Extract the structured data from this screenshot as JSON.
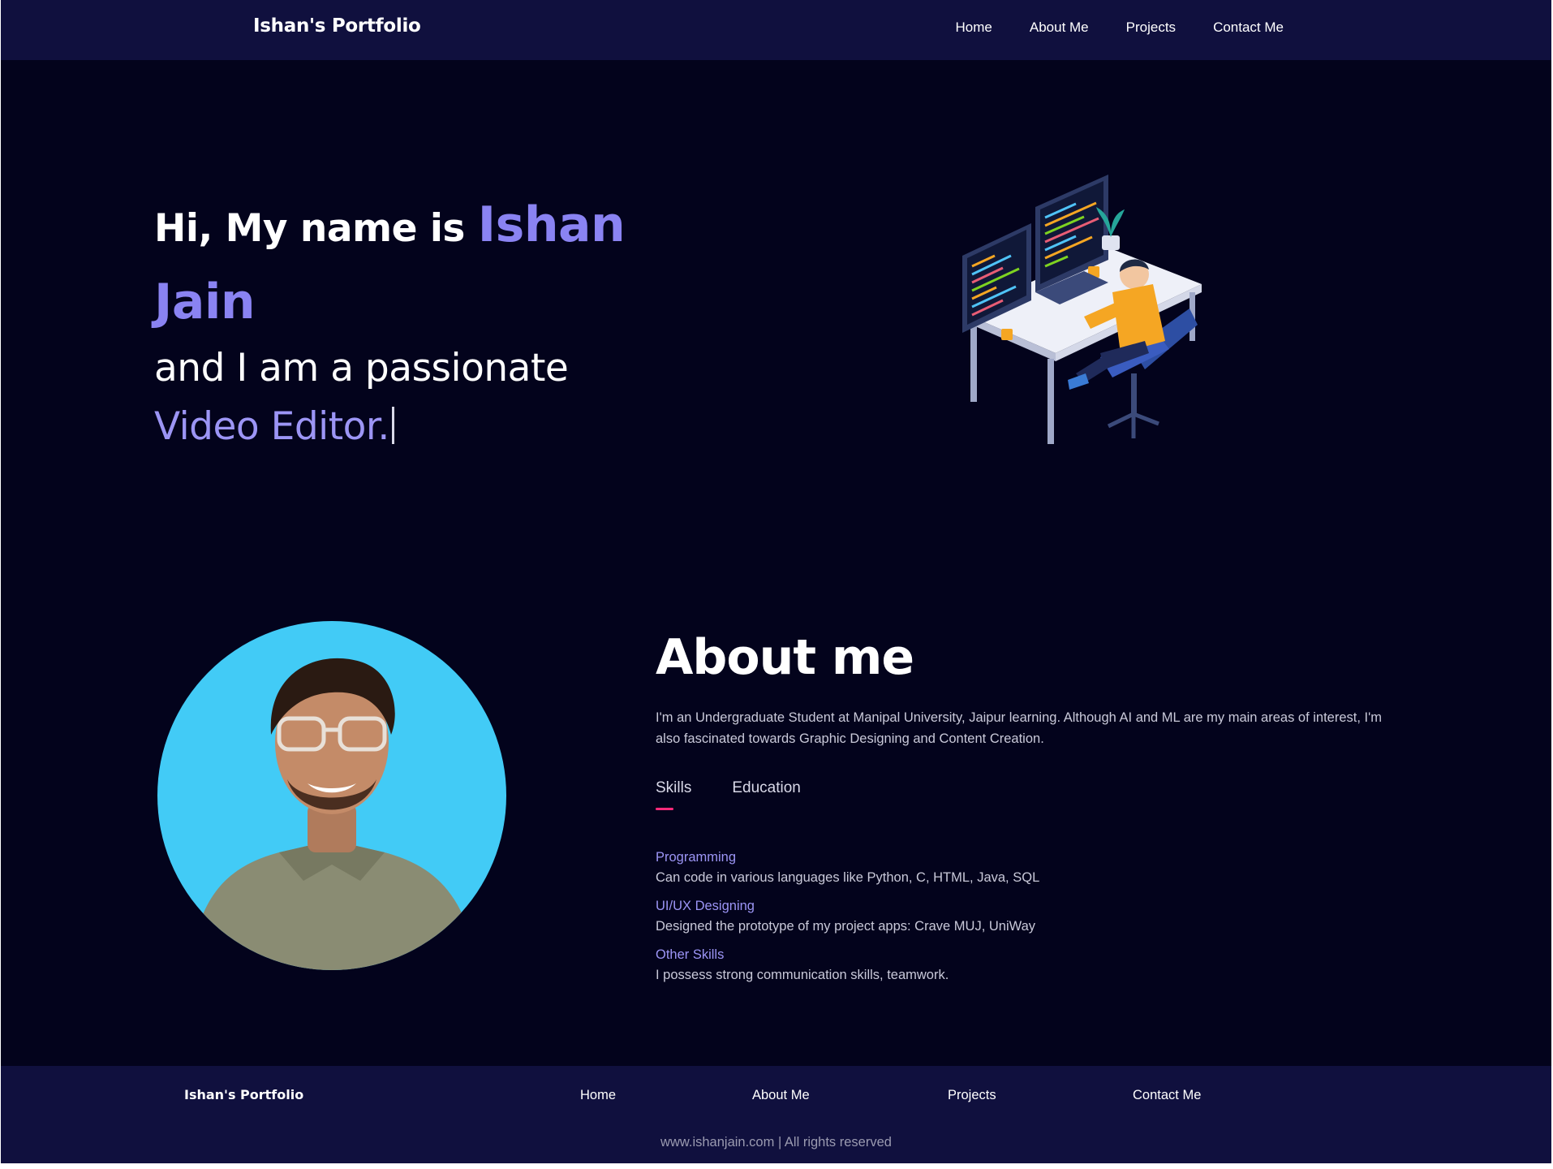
{
  "navbar": {
    "brand": "Ishan's Portfolio",
    "links": [
      "Home",
      "About Me",
      "Projects",
      "Contact Me"
    ]
  },
  "hero": {
    "greeting": "Hi, My name is",
    "name": "Ishan Jain",
    "tagline": "and I am a passionate",
    "role": "Video Editor.",
    "illustration": "developer-at-desk-illustration"
  },
  "about": {
    "photo": "profile-photo",
    "title": "About me",
    "text": "I'm an Undergraduate Student at Manipal University, Jaipur learning. Although AI and ML are my main areas of interest, I'm also fascinated towards Graphic Designing and Content Creation.",
    "tabs": [
      {
        "label": "Skills",
        "active": true
      },
      {
        "label": "Education",
        "active": false
      }
    ],
    "skills": [
      {
        "title": "Programming",
        "desc": "Can code in various languages like Python, C, HTML, Java, SQL"
      },
      {
        "title": "UI/UX Designing",
        "desc": "Designed the prototype of my project apps: Crave MUJ, UniWay"
      },
      {
        "title": "Other Skills",
        "desc": "I possess strong communication skills, teamwork."
      }
    ]
  },
  "footer": {
    "brand": "Ishan's Portfolio",
    "links": [
      "Home",
      "About Me",
      "Projects",
      "Contact Me"
    ],
    "copyright": "www.ishanjain.com | All rights reserved"
  },
  "colors": {
    "background": "#03031c",
    "navbar": "#10103e",
    "accent": "#8a83f2",
    "tab_underline": "#ff2a7a",
    "avatar_bg": "#42cbf6"
  }
}
